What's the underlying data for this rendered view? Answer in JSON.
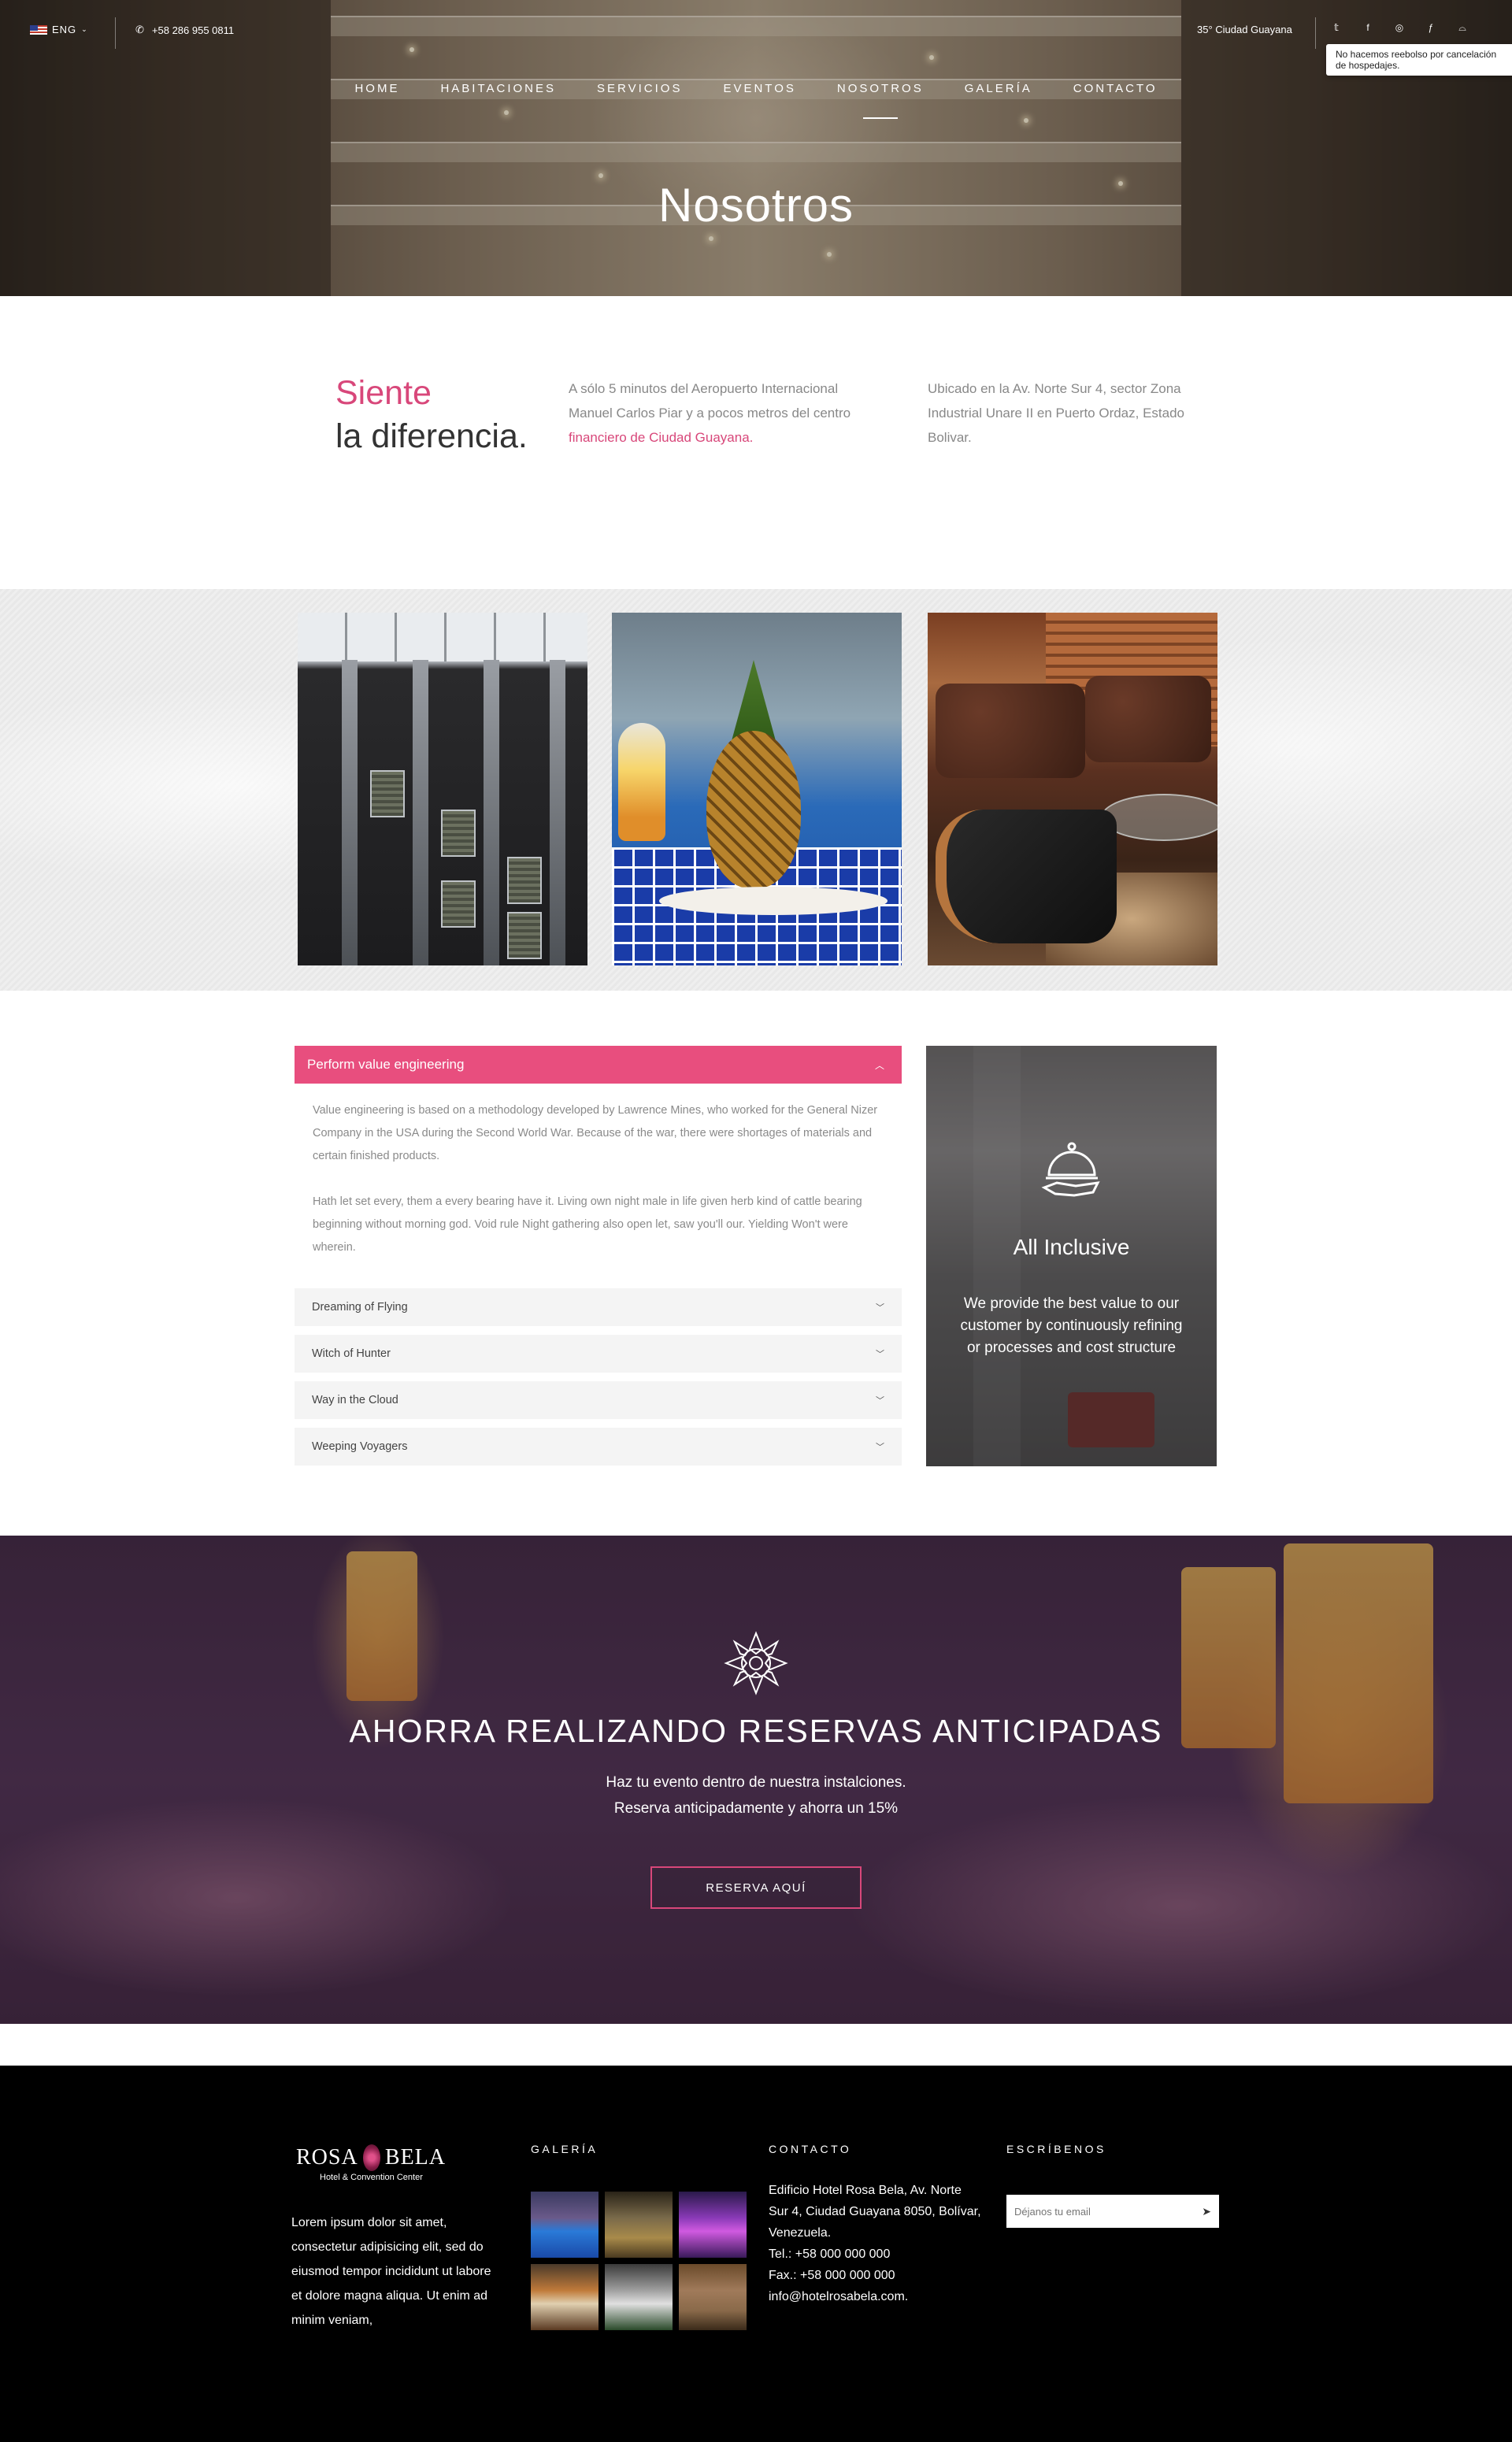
{
  "topbar": {
    "language": "ENG",
    "phone": "+58 286 955 0811",
    "weather": "35° Ciudad Guayana",
    "tooltip": "No hacemos reebolso por cancelación de hospedajes."
  },
  "nav": [
    {
      "label": "HOME"
    },
    {
      "label": "HABITACIONES"
    },
    {
      "label": "SERVICIOS"
    },
    {
      "label": "EVENTOS"
    },
    {
      "label": "NOSOTROS"
    },
    {
      "label": "GALERÍA"
    },
    {
      "label": "CONTACTO"
    }
  ],
  "hero": {
    "title": "Nosotros"
  },
  "intro": {
    "heading_highlight": "Siente",
    "heading_rest": "la diferencia.",
    "col1_text": "A sólo 5 minutos  del  Aeropuerto Internacional Manuel Carlos Piar y a pocos metros del centro ",
    "col1_link": "financiero de Ciudad Guayana.",
    "col2_text": "Ubicado en la Av. Norte Sur 4, sector Zona Industrial Unare II en Puerto Ordaz, Estado Bolivar."
  },
  "accordion": {
    "open_title": "Perform value engineering",
    "open_p1": "Value engineering is based on a methodology developed by Lawrence Mines, who worked for the General Nizer Company in the USA during the Second World War. Because of the war, there were shortages of materials and certain finished products.",
    "open_p2": "Hath let set every, them a every bearing have it. Living own night male in life given herb kind of cattle bearing beginning without morning god. Void rule Night gathering also open let, saw you'll our. Yielding Won't were wherein.",
    "items": [
      {
        "title": "Dreaming of Flying"
      },
      {
        "title": "Witch of Hunter"
      },
      {
        "title": "Way in the Cloud"
      },
      {
        "title": "Weeping Voyagers"
      }
    ]
  },
  "feature": {
    "title": "All Inclusive",
    "text": "We provide the best value to our customer by continuously refining or processes and cost structure"
  },
  "promo": {
    "title": "AHORRA REALIZANDO RESERVAS ANTICIPADAS",
    "line1": "Haz tu evento dentro de nuestra instalciones.",
    "line2": "Reserva anticipadamente y ahorra un 15%",
    "button": "RESERVA AQUÍ"
  },
  "footer": {
    "logo_left": "ROSA",
    "logo_right": "BELA",
    "logo_tag": "Hotel & Convention Center",
    "description": "Lorem ipsum dolor sit amet, consectetur adipisicing elit, sed do eiusmod tempor incididunt ut labore et dolore magna aliqua. Ut enim ad minim veniam,",
    "gallery_heading": "GALERÍA",
    "contact_heading": "CONTACTO",
    "contact_address": "Edificio Hotel Rosa Bela, Av. Norte Sur 4, Ciudad Guayana 8050, Bolívar, Venezuela.",
    "contact_tel": "Tel.: +58 000 000 000",
    "contact_fax": "Fax.: +58 000 000 000",
    "contact_email": "info@hotelrosabela.com.",
    "write_heading": "ESCRÍBENOS",
    "email_placeholder": "Déjanos tu email"
  }
}
